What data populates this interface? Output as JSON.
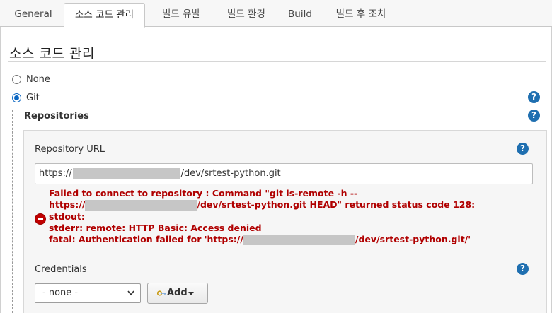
{
  "tabs": [
    "General",
    "소스 코드 관리",
    "빌드 유발",
    "빌드 환경",
    "Build",
    "빌드 후 조치"
  ],
  "section": {
    "title": "소스 코드 관리"
  },
  "scm": {
    "none_label": "None",
    "git_label": "Git",
    "selected": "Git"
  },
  "repositories": {
    "label": "Repositories",
    "url_label": "Repository URL",
    "url_prefix": "https://",
    "url_suffix": "/dev/srtest-python.git",
    "error": {
      "line1": "Failed to connect to repository : Command \"git ls-remote -h --",
      "line2_prefix": "https://",
      "line2_suffix": "/dev/srtest-python.git HEAD\" returned status code 128:",
      "line3": "stdout:",
      "line4": "stderr: remote: HTTP Basic: Access denied",
      "line5_prefix": "fatal: Authentication failed for 'https://",
      "line5_suffix": "/dev/srtest-python.git/'"
    },
    "credentials_label": "Credentials",
    "credentials_selected": "- none -",
    "add_label": "Add"
  },
  "help_glyph": "?",
  "colors": {
    "accent": "#0a66c2",
    "help": "#1f6fb0",
    "error": "#b00000"
  }
}
